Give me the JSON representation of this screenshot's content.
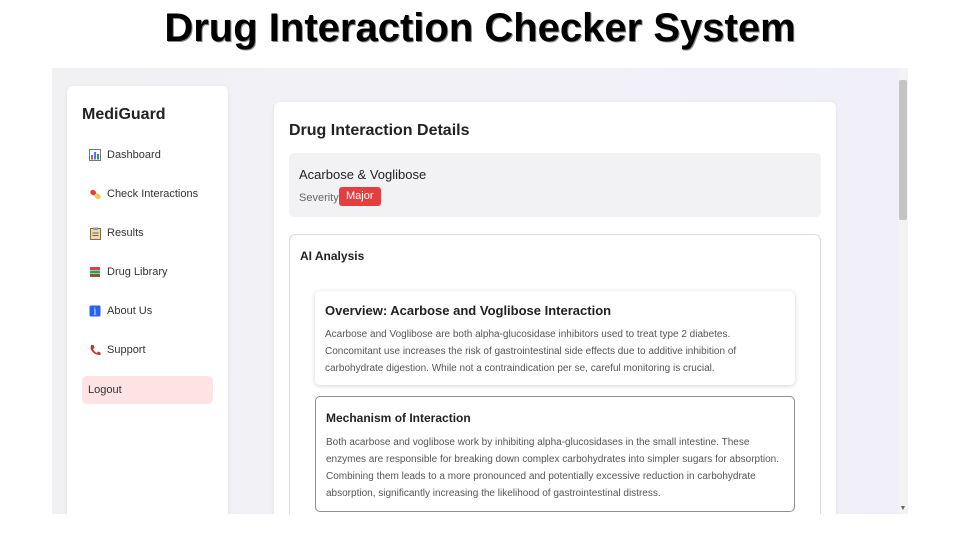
{
  "slide": {
    "title": "Drug Interaction Checker System"
  },
  "sidebar": {
    "brand": "MediGuard",
    "items": [
      {
        "label": "Dashboard",
        "icon": "chart-icon"
      },
      {
        "label": "Check Interactions",
        "icon": "pill-icon"
      },
      {
        "label": "Results",
        "icon": "clipboard-icon"
      },
      {
        "label": "Drug Library",
        "icon": "books-icon"
      },
      {
        "label": "About Us",
        "icon": "info-icon"
      },
      {
        "label": "Support",
        "icon": "phone-icon"
      }
    ],
    "logout": "Logout"
  },
  "main": {
    "title": "Drug Interaction Details",
    "pair": "Acarbose & Voglibose",
    "severity_label": "Severity:",
    "severity": "Major",
    "ai_title": "AI Analysis",
    "overview_title": "Overview: Acarbose and Voglibose Interaction",
    "overview_text": "Acarbose and Voglibose are both alpha-glucosidase inhibitors used to treat type 2 diabetes. Concomitant use increases the risk of gastrointestinal side effects due to additive inhibition of carbohydrate digestion. While not a contraindication per se, careful monitoring is crucial.",
    "mechanism_title": "Mechanism of Interaction",
    "mechanism_text": "Both acarbose and voglibose work by inhibiting alpha-glucosidases in the small intestine. These enzymes are responsible for breaking down complex carbohydrates into simpler sugars for absorption. Combining them leads to a more pronounced and potentially excessive reduction in carbohydrate absorption, significantly increasing the likelihood of gastrointestinal distress."
  },
  "colors": {
    "severity_major": "#e53e3e",
    "logout_bg": "#fde3e3"
  }
}
